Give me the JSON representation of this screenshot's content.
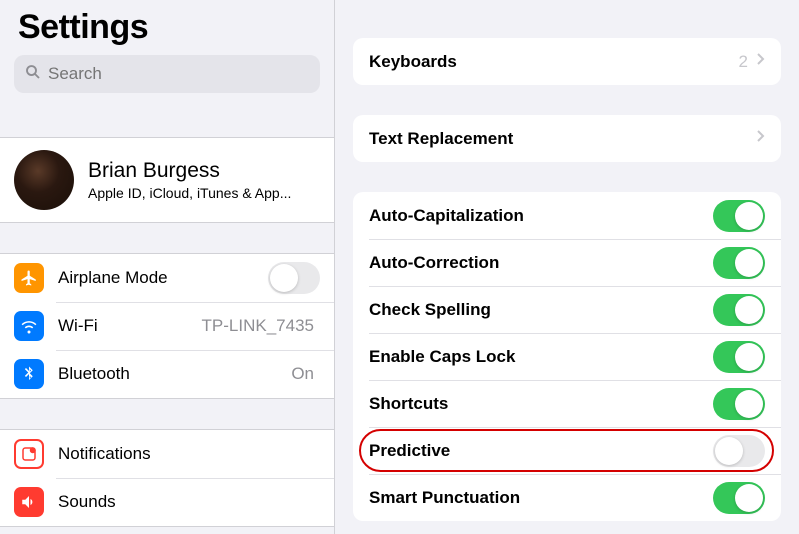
{
  "sidebar": {
    "title": "Settings",
    "search_placeholder": "Search",
    "apple_id": {
      "name": "Brian Burgess",
      "subtitle": "Apple ID, iCloud, iTunes & App..."
    },
    "group1": [
      {
        "label": "Airplane Mode",
        "icon": "airplane",
        "toggle": false
      },
      {
        "label": "Wi-Fi",
        "icon": "wifi",
        "value": "TP-LINK_7435"
      },
      {
        "label": "Bluetooth",
        "icon": "bluetooth",
        "value": "On"
      }
    ],
    "group2": [
      {
        "label": "Notifications",
        "icon": "notifications"
      },
      {
        "label": "Sounds",
        "icon": "sounds"
      }
    ]
  },
  "main": {
    "keyboards": {
      "label": "Keyboards",
      "count": "2"
    },
    "text_replacement": {
      "label": "Text Replacement"
    },
    "switches": [
      {
        "label": "Auto-Capitalization",
        "on": true
      },
      {
        "label": "Auto-Correction",
        "on": true
      },
      {
        "label": "Check Spelling",
        "on": true
      },
      {
        "label": "Enable Caps Lock",
        "on": true
      },
      {
        "label": "Shortcuts",
        "on": true
      },
      {
        "label": "Predictive",
        "on": false,
        "highlighted": true
      },
      {
        "label": "Smart Punctuation",
        "on": true
      }
    ]
  }
}
